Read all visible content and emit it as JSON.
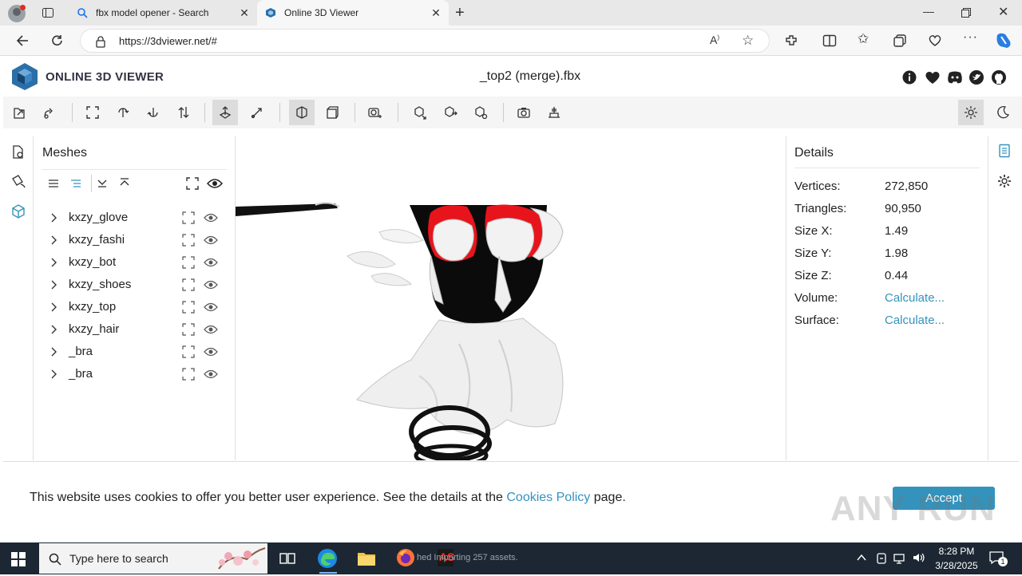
{
  "browser": {
    "tabs": [
      {
        "title": "fbx model opener - Search"
      },
      {
        "title": "Online 3D Viewer"
      }
    ],
    "url": "https://3dviewer.net/#"
  },
  "app": {
    "logo_text": "ONLINE 3D VIEWER",
    "file_name": "_top2 (merge).fbx"
  },
  "meshes": {
    "title": "Meshes",
    "items": [
      {
        "name": "kxzy_glove"
      },
      {
        "name": "kxzy_fashi"
      },
      {
        "name": "kxzy_bot"
      },
      {
        "name": "kxzy_shoes"
      },
      {
        "name": "kxzy_top"
      },
      {
        "name": "kxzy_hair"
      },
      {
        "name": "_bra"
      },
      {
        "name": "_bra"
      }
    ]
  },
  "details": {
    "title": "Details",
    "rows": [
      {
        "key": "Vertices:",
        "value": "272,850"
      },
      {
        "key": "Triangles:",
        "value": "90,950"
      },
      {
        "key": "Size X:",
        "value": "1.49"
      },
      {
        "key": "Size Y:",
        "value": "1.98"
      },
      {
        "key": "Size Z:",
        "value": "0.44"
      },
      {
        "key": "Volume:",
        "value": "Calculate..."
      },
      {
        "key": "Surface:",
        "value": "Calculate..."
      }
    ]
  },
  "cookie": {
    "text_before": "This website uses cookies to offer you better user experience. See the details at the ",
    "link": "Cookies Policy",
    "text_after": " page.",
    "accept": "Accept"
  },
  "watermark": "ANY RUN",
  "taskbar": {
    "search_placeholder": "Type here to search",
    "status_text": "hed  Importing 257 assets.",
    "time": "8:28 PM",
    "date": "3/28/2025",
    "notification_count": "1"
  },
  "colors": {
    "accent": "#3393bd",
    "logo": "#2b6fa8",
    "taskbar": "#1c2733"
  }
}
